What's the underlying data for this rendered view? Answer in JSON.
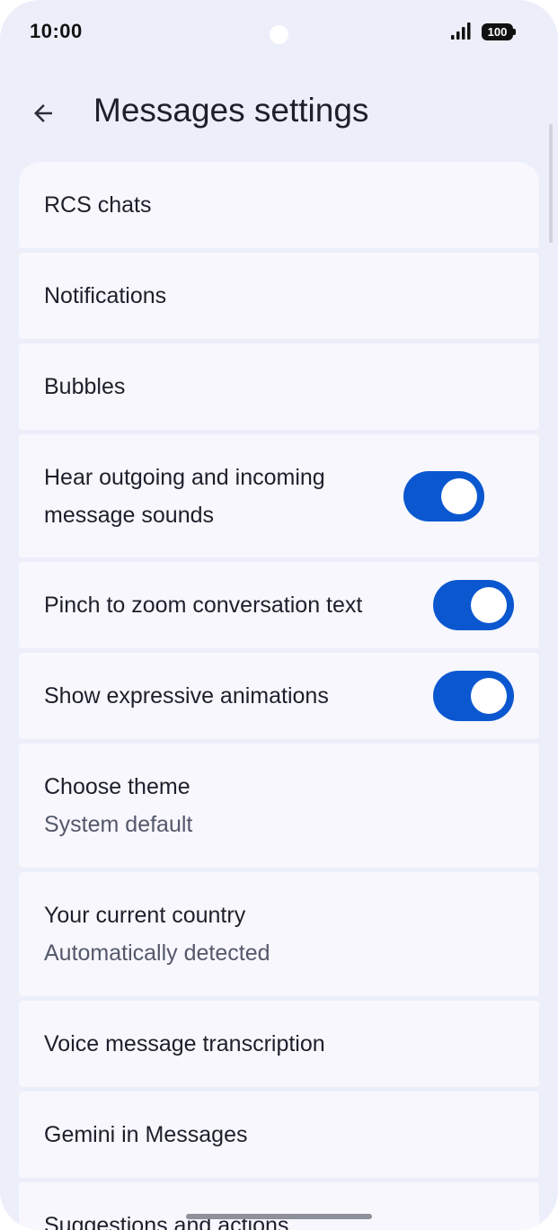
{
  "status_bar": {
    "time": "10:00",
    "battery": "100",
    "icons": [
      "signal-icon",
      "battery-icon"
    ]
  },
  "header": {
    "title": "Messages settings",
    "back_icon": "arrow-back-icon"
  },
  "colors": {
    "background": "#eceef9",
    "card": "#f7f7fd",
    "toggle_on": "#0b57d0"
  },
  "settings": {
    "rcs_chats": "RCS chats",
    "notifications": "Notifications",
    "bubbles": "Bubbles",
    "hear_sounds": "Hear outgoing and incoming message sounds",
    "hear_sounds_on": true,
    "pinch_zoom": "Pinch to zoom conversation text",
    "pinch_zoom_on": true,
    "expressive_animations": "Show expressive animations",
    "expressive_animations_on": true,
    "choose_theme": "Choose theme",
    "choose_theme_value": "System default",
    "current_country": "Your current country",
    "current_country_value": "Automatically detected",
    "voice_transcription": "Voice message transcription",
    "gemini": "Gemini in Messages",
    "suggestions": "Suggestions and actions"
  }
}
